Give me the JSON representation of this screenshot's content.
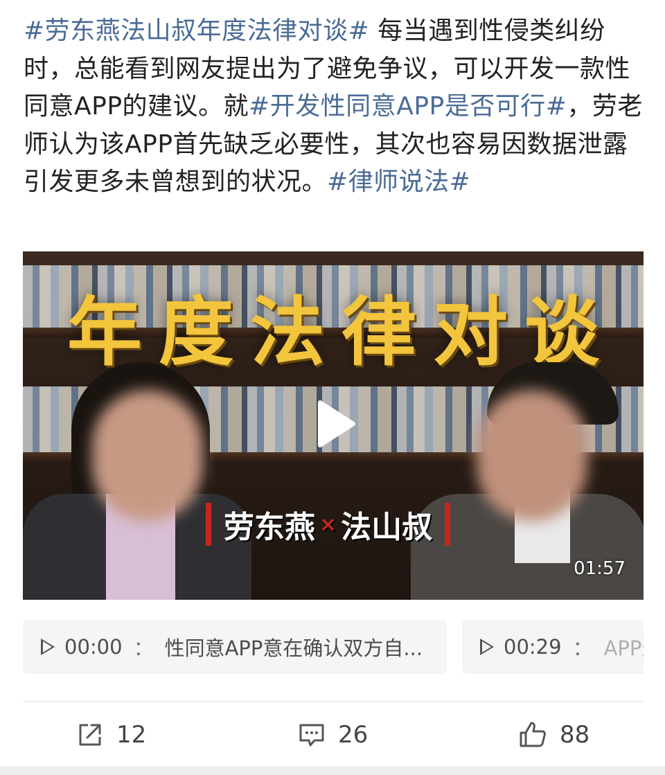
{
  "post": {
    "tag1": "#劳东燕法山叔年度法律对谈#",
    "text1": " 每当遇到性侵类纠纷时，总能看到网友提出为了避免争议，可以开发一款性同意APP的建议。就",
    "tag2": "#开发性同意APP是否可行#",
    "text2": "，劳老师认为该APP首先缺乏必要性，其次也容易因数据泄露引发更多未曾想到的状况。",
    "tag3": "#律师说法#"
  },
  "video": {
    "title_overlay": "年度法律对谈",
    "name_left": "劳东燕",
    "name_sep": "×",
    "name_right": "法山叔",
    "duration": "01:57",
    "play_icon": "play-icon"
  },
  "chapters": [
    {
      "time": "00:00",
      "sep": "：",
      "desc": "性同意APP意在确认双方自..."
    },
    {
      "time": "00:29",
      "sep": "：",
      "desc": "APP这"
    }
  ],
  "actions": {
    "share_count": "12",
    "comment_count": "26",
    "like_count": "88",
    "share_icon": "share-icon",
    "comment_icon": "comment-icon",
    "like_icon": "thumbs-up-icon"
  },
  "colors": {
    "link": "#4a6b96",
    "title_gold": "#f3c53d",
    "banner_red": "#c7261e"
  }
}
